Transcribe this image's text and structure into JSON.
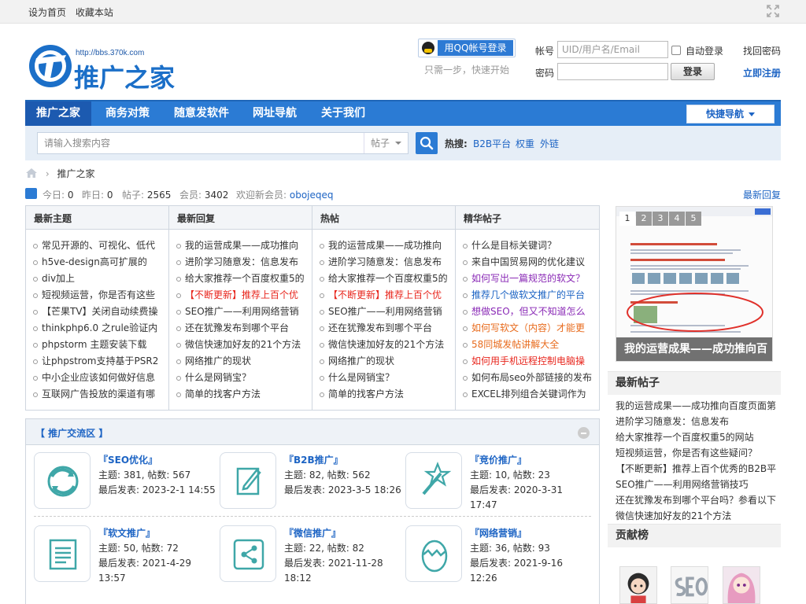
{
  "topbar": {
    "set_home": "设为首页",
    "bookmark": "收藏本站"
  },
  "header": {
    "logo_url": "http://bbs.370k.com",
    "logo_name": "推广之家",
    "qq_login_label": "用QQ帐号登录",
    "qq_hint": "只需一步，快速开始",
    "account_label": "帐号",
    "account_placeholder": "UID/用户名/Email",
    "password_label": "密码",
    "auto_login": "自动登录",
    "find_password": "找回密码",
    "login_button": "登录",
    "register": "立即注册"
  },
  "nav": {
    "items": [
      "推广之家",
      "商务对策",
      "随意发软件",
      "网址导航",
      "关于我们"
    ],
    "quick_nav": "快捷导航"
  },
  "search": {
    "placeholder": "请输入搜索内容",
    "scope": "帖子",
    "hot_label": "热搜:",
    "hot_links": [
      "B2B平台",
      "权重",
      "外链"
    ]
  },
  "breadcrumb": {
    "current": "推广之家",
    "separator": "›"
  },
  "stats": {
    "today_label": "今日:",
    "today": "0",
    "yesterday_label": "昨日:",
    "yesterday": "0",
    "posts_label": "帖子:",
    "posts": "2565",
    "members_label": "会员:",
    "members": "3402",
    "welcome_label": "欢迎新会员:",
    "new_member": "obojeqeq",
    "latest_reply": "最新回复"
  },
  "tabs": [
    {
      "title": "最新主题",
      "items": [
        {
          "text": "常见开源的、可视化、低代",
          "color": "#333333"
        },
        {
          "text": "h5ve-design高可扩展的",
          "color": "#333333"
        },
        {
          "text": "div加上",
          "color": "#333333"
        },
        {
          "text": "短视频运营，你是否有这些",
          "color": "#333333"
        },
        {
          "text": "【芒果TV】关闭自动续费操",
          "color": "#333333"
        },
        {
          "text": "thinkphp6.0 之rule验证内",
          "color": "#333333"
        },
        {
          "text": "phpstorm 主题安装下载",
          "color": "#333333"
        },
        {
          "text": "让phpstrom支持基于PSR2",
          "color": "#333333"
        },
        {
          "text": "中小企业应该如何做好信息",
          "color": "#333333"
        },
        {
          "text": "互联网广告投放的渠道有哪",
          "color": "#333333"
        }
      ]
    },
    {
      "title": "最新回复",
      "items": [
        {
          "text": "我的运营成果——成功推向",
          "color": "#333333"
        },
        {
          "text": "进阶学习随意发：信息发布",
          "color": "#333333"
        },
        {
          "text": "给大家推荐一个百度权重5的",
          "color": "#333333"
        },
        {
          "text": "【不断更新】推荐上百个优",
          "color": "#e8261d"
        },
        {
          "text": "SEO推广——利用网络营销",
          "color": "#333333"
        },
        {
          "text": "还在犹豫发布到哪个平台",
          "color": "#333333"
        },
        {
          "text": "微信快速加好友的21个方法",
          "color": "#333333"
        },
        {
          "text": "网络推广的现状",
          "color": "#333333"
        },
        {
          "text": "什么是网销宝？",
          "color": "#333333"
        },
        {
          "text": "简单的找客户方法",
          "color": "#333333"
        }
      ]
    },
    {
      "title": "热帖",
      "items": [
        {
          "text": "我的运营成果——成功推向",
          "color": "#333333"
        },
        {
          "text": "进阶学习随意发：信息发布",
          "color": "#333333"
        },
        {
          "text": "给大家推荐一个百度权重5的",
          "color": "#333333"
        },
        {
          "text": "【不断更新】推荐上百个优",
          "color": "#e8261d"
        },
        {
          "text": "SEO推广——利用网络营销",
          "color": "#333333"
        },
        {
          "text": "还在犹豫发布到哪个平台",
          "color": "#333333"
        },
        {
          "text": "微信快速加好友的21个方法",
          "color": "#333333"
        },
        {
          "text": "网络推广的现状",
          "color": "#333333"
        },
        {
          "text": "什么是网销宝？",
          "color": "#333333"
        },
        {
          "text": "简单的找客户方法",
          "color": "#333333"
        }
      ]
    },
    {
      "title": "精华帖子",
      "items": [
        {
          "text": "什么是目标关键词？",
          "color": "#333333"
        },
        {
          "text": "来自中国贸易网的优化建议",
          "color": "#333333"
        },
        {
          "text": "如何写出一篇规范的软文？",
          "color": "#8a2ab6"
        },
        {
          "text": "推荐几个做软文推广的平台",
          "color": "#1d64c4"
        },
        {
          "text": "想做SEO，但又不知道怎么",
          "color": "#8a2ab6"
        },
        {
          "text": "如何写软文（内容）才能更",
          "color": "#e86b1d"
        },
        {
          "text": "58同城发帖讲解大全",
          "color": "#e86b1d"
        },
        {
          "text": "如何用手机远程控制电脑操",
          "color": "#e8261d"
        },
        {
          "text": "如何布局seo外部链接的发布",
          "color": "#333333"
        },
        {
          "text": "EXCEL排列组合关键词作为",
          "color": "#333333"
        }
      ]
    }
  ],
  "forum": {
    "title": "【 推广交流区 】",
    "boards": [
      {
        "name": "『SEO优化』",
        "topics_label": "主题:",
        "topics": "381",
        "posts_label": "帖数:",
        "posts": "567",
        "last_label": "最后发表:",
        "last": "2023-2-1 14:55",
        "icon": "refresh-icon"
      },
      {
        "name": "『B2B推广』",
        "topics_label": "主题:",
        "topics": "82",
        "posts_label": "帖数:",
        "posts": "562",
        "last_label": "最后发表:",
        "last": "2023-3-5 18:26",
        "icon": "edit-icon"
      },
      {
        "name": "『竞价推广』",
        "topics_label": "主题:",
        "topics": "10",
        "posts_label": "帖数:",
        "posts": "23",
        "last_label": "最后发表:",
        "last": "2020-3-31 17:47",
        "icon": "magic-wand-icon"
      },
      {
        "name": "『软文推广』",
        "topics_label": "主题:",
        "topics": "50",
        "posts_label": "帖数:",
        "posts": "72",
        "last_label": "最后发表:",
        "last": "2021-4-29 13:57",
        "icon": "document-icon"
      },
      {
        "name": "『微信推广』",
        "topics_label": "主题:",
        "topics": "22",
        "posts_label": "帖数:",
        "posts": "82",
        "last_label": "最后发表:",
        "last": "2021-11-28 18:12",
        "icon": "share-icon"
      },
      {
        "name": "『网络营销』",
        "topics_label": "主题:",
        "topics": "36",
        "posts_label": "帖数:",
        "posts": "93",
        "last_label": "最后发表:",
        "last": "2021-9-16 12:26",
        "icon": "egg-icon"
      }
    ]
  },
  "slider": {
    "pages": [
      "1",
      "2",
      "3",
      "4",
      "5"
    ],
    "caption": "我的运营成果——成功推向百"
  },
  "latest_posts": {
    "title": "最新帖子",
    "items": [
      "我的运营成果——成功推向百度页面第",
      "进阶学习随意发：信息发布",
      "给大家推荐一个百度权重5的网站",
      "短视频运营，你是否有这些疑问？",
      "【不断更新】推荐上百个优秀的B2B平",
      "SEO推广——利用网络营销技巧",
      "还在犹豫发布到哪个平台吗？参看以下",
      "微信快速加好友的21个方法"
    ]
  },
  "contributors": {
    "title": "贡献榜"
  },
  "colors": {
    "brand_blue": "#2b7bd4",
    "link_blue": "#1d64c4",
    "hot_red": "#e8261d"
  }
}
